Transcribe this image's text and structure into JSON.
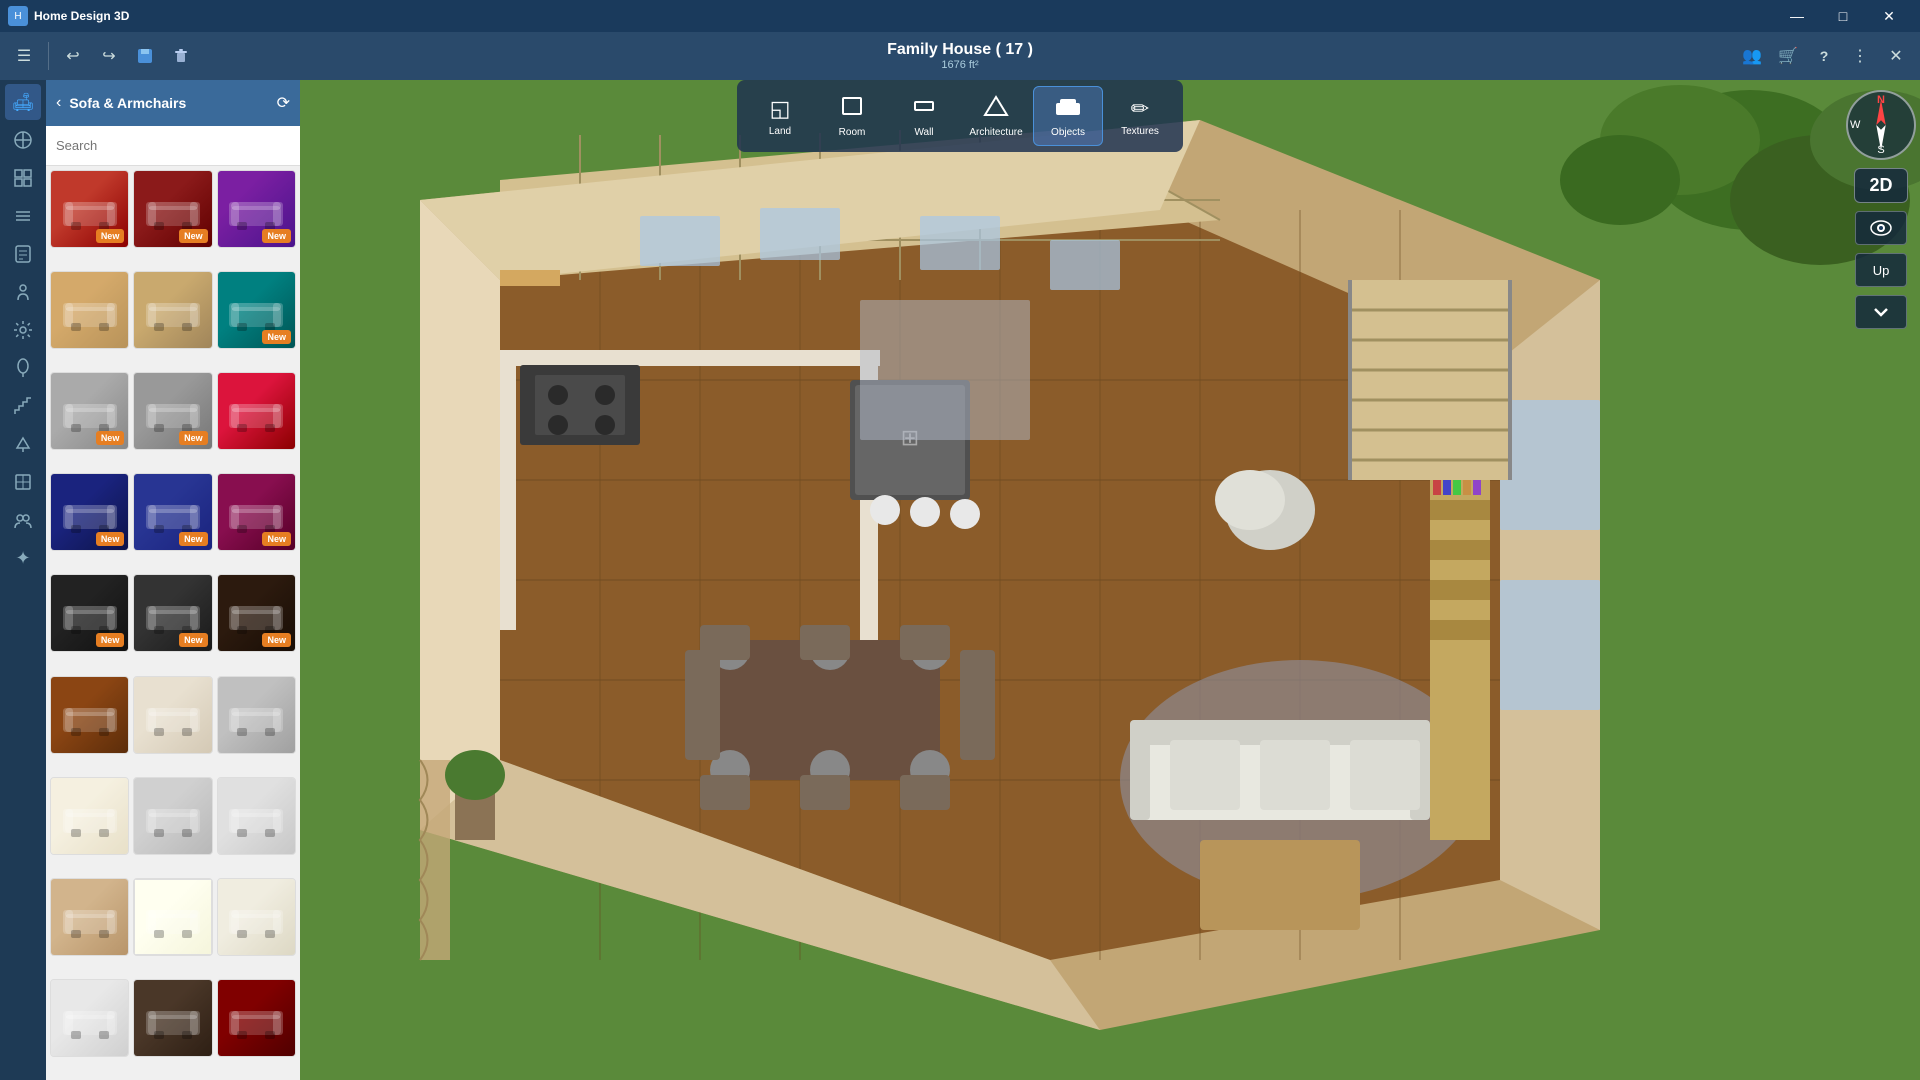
{
  "window": {
    "title": "Home Design 3D",
    "minimize": "—",
    "maximize": "□",
    "close": "✕"
  },
  "toolbar": {
    "undo_label": "↩",
    "redo_label": "↪",
    "save_label": "💾",
    "trash_label": "🗑"
  },
  "title_center": {
    "house_name": "Family House ( 17 )",
    "house_area": "1676 ft²"
  },
  "main_toolbar": {
    "items": [
      {
        "id": "land",
        "label": "Land",
        "icon": "◱"
      },
      {
        "id": "room",
        "label": "Room",
        "icon": "⬜"
      },
      {
        "id": "wall",
        "label": "Wall",
        "icon": "⊡"
      },
      {
        "id": "architecture",
        "label": "Architecture",
        "icon": "🏠"
      },
      {
        "id": "objects",
        "label": "Objects",
        "icon": "🛋"
      },
      {
        "id": "textures",
        "label": "Textures",
        "icon": "✏"
      }
    ],
    "active": "objects"
  },
  "sidebar": {
    "icons": [
      {
        "id": "sofa",
        "icon": "🛋",
        "active": true
      },
      {
        "id": "tools",
        "icon": "✏"
      },
      {
        "id": "grid",
        "icon": "⊞"
      },
      {
        "id": "layers",
        "icon": "≡"
      },
      {
        "id": "note",
        "icon": "📋"
      },
      {
        "id": "person",
        "icon": "👤"
      },
      {
        "id": "settings",
        "icon": "⚙"
      },
      {
        "id": "plant",
        "icon": "🌿"
      },
      {
        "id": "stairs",
        "icon": "⊏"
      },
      {
        "id": "lamp",
        "icon": "💡"
      },
      {
        "id": "window_icon",
        "icon": "⬚"
      },
      {
        "id": "group",
        "icon": "👥"
      },
      {
        "id": "symbol",
        "icon": "✦"
      }
    ]
  },
  "panel": {
    "title": "Sofa & Armchairs",
    "back_label": "‹",
    "refresh_label": "⟳",
    "search_placeholder": "Search"
  },
  "items": [
    {
      "id": 1,
      "style": "sofa-red",
      "new": true
    },
    {
      "id": 2,
      "style": "sofa-darkred",
      "new": true
    },
    {
      "id": 3,
      "style": "sofa-wine",
      "new": true
    },
    {
      "id": 4,
      "style": "sofa-beige",
      "new": false
    },
    {
      "id": 5,
      "style": "sofa-beige2",
      "new": false
    },
    {
      "id": 6,
      "style": "sofa-teal",
      "new": true
    },
    {
      "id": 7,
      "style": "sofa-gray",
      "new": true
    },
    {
      "id": 8,
      "style": "sofa-gray2",
      "new": true
    },
    {
      "id": 9,
      "style": "sofa-crimson",
      "new": false
    },
    {
      "id": 10,
      "style": "sofa-darkblue",
      "new": true
    },
    {
      "id": 11,
      "style": "sofa-navyblue",
      "new": true
    },
    {
      "id": 12,
      "style": "sofa-darkwine",
      "new": true
    },
    {
      "id": 13,
      "style": "sofa-black",
      "new": true
    },
    {
      "id": 14,
      "style": "sofa-charcoal",
      "new": true
    },
    {
      "id": 15,
      "style": "sofa-darkbrown",
      "new": true
    },
    {
      "id": 16,
      "style": "sofa-cognac",
      "new": false
    },
    {
      "id": 17,
      "style": "sofa-offwhite",
      "new": false
    },
    {
      "id": 18,
      "style": "sofa-silver",
      "new": false
    },
    {
      "id": 19,
      "style": "sofa-cream",
      "new": false
    },
    {
      "id": 20,
      "style": "sofa-lightgray",
      "new": false
    },
    {
      "id": 21,
      "style": "sofa-graywhite",
      "new": false
    },
    {
      "id": 22,
      "style": "sofa-tan",
      "new": false
    },
    {
      "id": 23,
      "style": "sofa-ivory",
      "new": false
    },
    {
      "id": 24,
      "style": "sofa-lt",
      "new": false
    },
    {
      "id": 25,
      "style": "sofa-wh",
      "new": false
    },
    {
      "id": 26,
      "style": "sofa-dk",
      "new": false
    },
    {
      "id": 27,
      "style": "sofa-maroon",
      "new": false
    }
  ],
  "new_badge": "New",
  "compass": {
    "n": "N",
    "s": "S",
    "w": "W"
  },
  "view_2d": "2D",
  "view_up": "Up",
  "view_down": "↓",
  "right_toolbar": {
    "people_icon": "👥",
    "cart_icon": "🛒",
    "help_icon": "?",
    "menu_icon": "⋮",
    "collapse_icon": "✕"
  }
}
